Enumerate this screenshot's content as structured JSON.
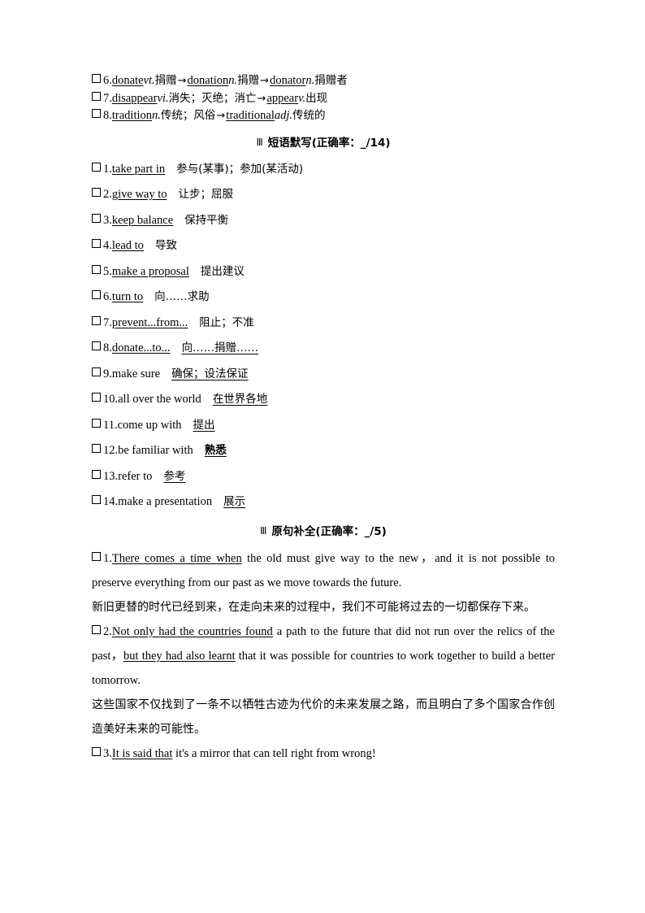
{
  "word_section": {
    "items": [
      {
        "checkbox": true,
        "num": "6.",
        "parts": [
          {
            "t": "donate",
            "u": true
          },
          {
            "t": "vt.",
            "i": true
          },
          {
            "t": "捐赠",
            "cn": true
          },
          {
            "t": "→",
            "arrow": true
          },
          {
            "t": "donation",
            "u": true
          },
          {
            "t": "n.",
            "i": true
          },
          {
            "t": "捐赠",
            "cn": true
          },
          {
            "t": "→",
            "arrow": true
          },
          {
            "t": "donator",
            "u": true
          },
          {
            "t": "n.",
            "i": true
          },
          {
            "t": "捐赠者",
            "cn": true
          }
        ]
      },
      {
        "checkbox": true,
        "num": "7.",
        "parts": [
          {
            "t": "disappear",
            "u": true
          },
          {
            "t": "vi.",
            "i": true
          },
          {
            "t": "消失；灭绝；消亡 ",
            "cn": true
          },
          {
            "t": "→",
            "arrow": true
          },
          {
            "t": "appear",
            "u": true
          },
          {
            "t": "v.",
            "i": true
          },
          {
            "t": "出现",
            "cn": true
          }
        ]
      },
      {
        "checkbox": true,
        "num": "8.",
        "parts": [
          {
            "t": "tradition",
            "u": true
          },
          {
            "t": "n.",
            "i": true
          },
          {
            "t": "传统；风俗",
            "cn": true
          },
          {
            "t": "→",
            "arrow": true
          },
          {
            "t": "traditional",
            "u": true
          },
          {
            "t": "adj.",
            "i": true
          },
          {
            "t": "传统的",
            "cn": true
          }
        ]
      }
    ]
  },
  "phrase_section": {
    "heading_mark": "Ⅲ",
    "heading_title": "短语默写(正确率：_/14)",
    "items": [
      {
        "checkbox": true,
        "num": "1.",
        "eng": "take part in",
        "eng_underline": true,
        "answer": "参与(某事)；参加(某活动)",
        "answer_underline": false,
        "bold": false
      },
      {
        "checkbox": true,
        "num": "2.",
        "eng": "give way to",
        "eng_underline": true,
        "answer": "让步；屈服",
        "answer_underline": false,
        "bold": false
      },
      {
        "checkbox": true,
        "num": "3.",
        "eng": "keep balance",
        "eng_underline": true,
        "answer": "保持平衡",
        "answer_underline": false,
        "bold": false
      },
      {
        "checkbox": true,
        "num": "4.",
        "eng": "lead to",
        "eng_underline": true,
        "answer": "导致",
        "answer_underline": false,
        "bold": false
      },
      {
        "checkbox": true,
        "num": "5.",
        "eng": "make a proposal",
        "eng_underline": true,
        "answer": "提出建议",
        "answer_underline": false,
        "bold": false
      },
      {
        "checkbox": true,
        "num": "6.",
        "eng": "turn to",
        "eng_underline": true,
        "answer": "向……求助",
        "answer_underline": false,
        "bold": false
      },
      {
        "checkbox": true,
        "num": "7.",
        "eng": "prevent...from...",
        "eng_underline": true,
        "answer": "阻止；不准",
        "answer_underline": false,
        "bold": false
      },
      {
        "checkbox": true,
        "num": "8.",
        "eng": "donate...to...",
        "eng_underline": true,
        "answer": "向……捐赠……",
        "answer_underline": true,
        "bold": false
      },
      {
        "checkbox": true,
        "num": "9.",
        "eng": "make sure",
        "eng_underline": false,
        "answer": "确保；设法保证",
        "answer_underline": true,
        "bold": false
      },
      {
        "checkbox": true,
        "num": "10.",
        "eng": "all over the world",
        "eng_underline": false,
        "answer": "在世界各地",
        "answer_underline": true,
        "bold": false
      },
      {
        "checkbox": true,
        "num": "11.",
        "eng": "come up with",
        "eng_underline": false,
        "answer": "提出",
        "answer_underline": true,
        "bold": false
      },
      {
        "checkbox": true,
        "num": "12.",
        "eng": "be familiar with",
        "eng_underline": false,
        "answer": "熟悉",
        "answer_underline": true,
        "bold": true
      },
      {
        "checkbox": true,
        "num": "13.",
        "eng": "refer to",
        "eng_underline": false,
        "answer": "参考",
        "answer_underline": true,
        "bold": false
      },
      {
        "checkbox": true,
        "num": "14.",
        "eng": "make a presentation",
        "eng_underline": false,
        "answer": "展示",
        "answer_underline": true,
        "bold": false
      }
    ]
  },
  "sentence_section": {
    "heading_mark": "Ⅲ",
    "heading_title": "原句补全(正确率：_/5)",
    "items": [
      {
        "num": "1.",
        "blank": "There comes a time when",
        "rest": " the old must give way to the new，and it is not possible to preserve everything from our past as we move towards the future.",
        "translation": "新旧更替的时代已经到来，在走向未来的过程中，我们不可能将过去的一切都保存下来。"
      },
      {
        "num": "2.",
        "blank": "Not only had the countries found",
        "rest": " a path to the future that did not run over the relics of the past，",
        "blank2": "but they had also learnt",
        "rest2": " that it was possible for countries to work together to build a better tomorrow.",
        "translation": "这些国家不仅找到了一条不以牺牲古迹为代价的未来发展之路，而且明白了多个国家合作创造美好未来的可能性。"
      },
      {
        "num": "3.",
        "blank": "It is said that",
        "rest": " it's a mirror that can tell right from wrong!"
      }
    ]
  }
}
